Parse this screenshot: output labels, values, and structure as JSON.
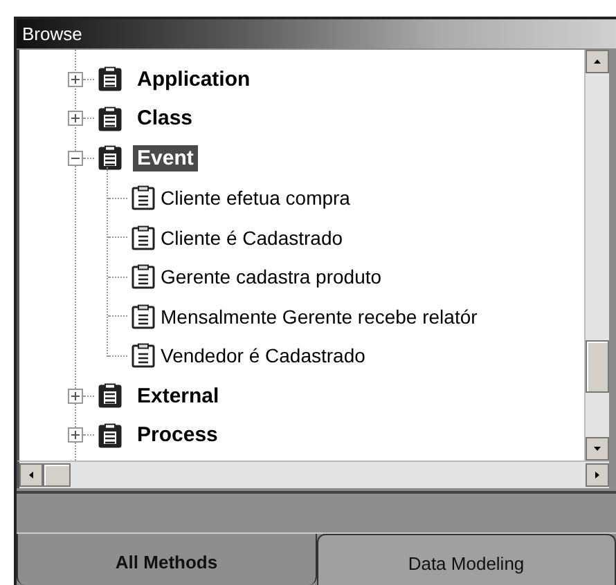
{
  "panel": {
    "title": "Browse"
  },
  "tree": [
    {
      "label": "Application",
      "expanded": false,
      "selected": false
    },
    {
      "label": "Class",
      "expanded": false,
      "selected": false
    },
    {
      "label": "Event",
      "expanded": true,
      "selected": true,
      "children": [
        {
          "label": "Cliente efetua compra",
          "selected": false
        },
        {
          "label": "Cliente é Cadastrado",
          "selected": false
        },
        {
          "label": "Gerente cadastra produto",
          "selected": false
        },
        {
          "label": "Mensalmente Gerente recebe relatór",
          "selected": false
        },
        {
          "label": "Vendedor é Cadastrado",
          "selected": false
        }
      ]
    },
    {
      "label": "External",
      "expanded": false,
      "selected": false
    },
    {
      "label": "Process",
      "expanded": false,
      "selected": false
    }
  ],
  "tabs": [
    {
      "label": "All Methods",
      "selected": true
    },
    {
      "label": "Data Modeling",
      "selected": false
    }
  ]
}
